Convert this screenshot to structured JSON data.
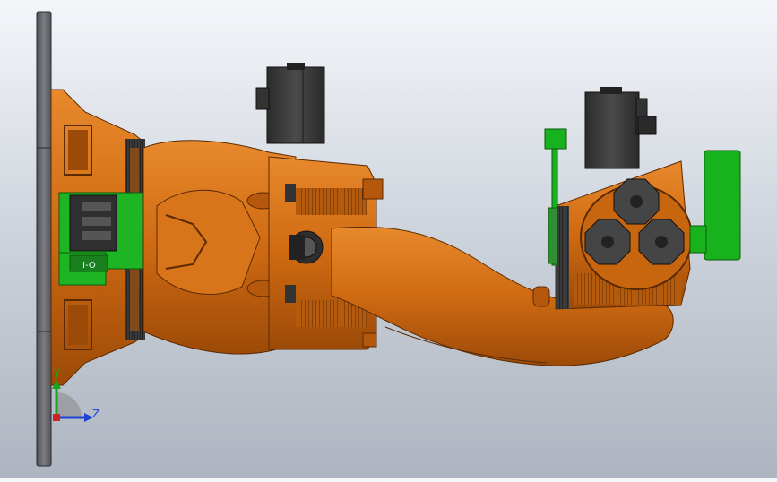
{
  "viewport": {
    "background_top": "#f4f6fa",
    "background_bottom": "#aeb5c0"
  },
  "model": {
    "body_color": "#cf6a12",
    "body_shadow": "#9c4a08",
    "body_highlight": "#e58a2e",
    "motor_color": "#3e3e3e",
    "accent_green": "#19b21f",
    "base_plate_color": "#6b6d72",
    "connector_label": "I-O"
  },
  "triad": {
    "y_label": "Y",
    "z_label": "Z",
    "y_color": "#18a51c",
    "z_color": "#1f44d4"
  }
}
